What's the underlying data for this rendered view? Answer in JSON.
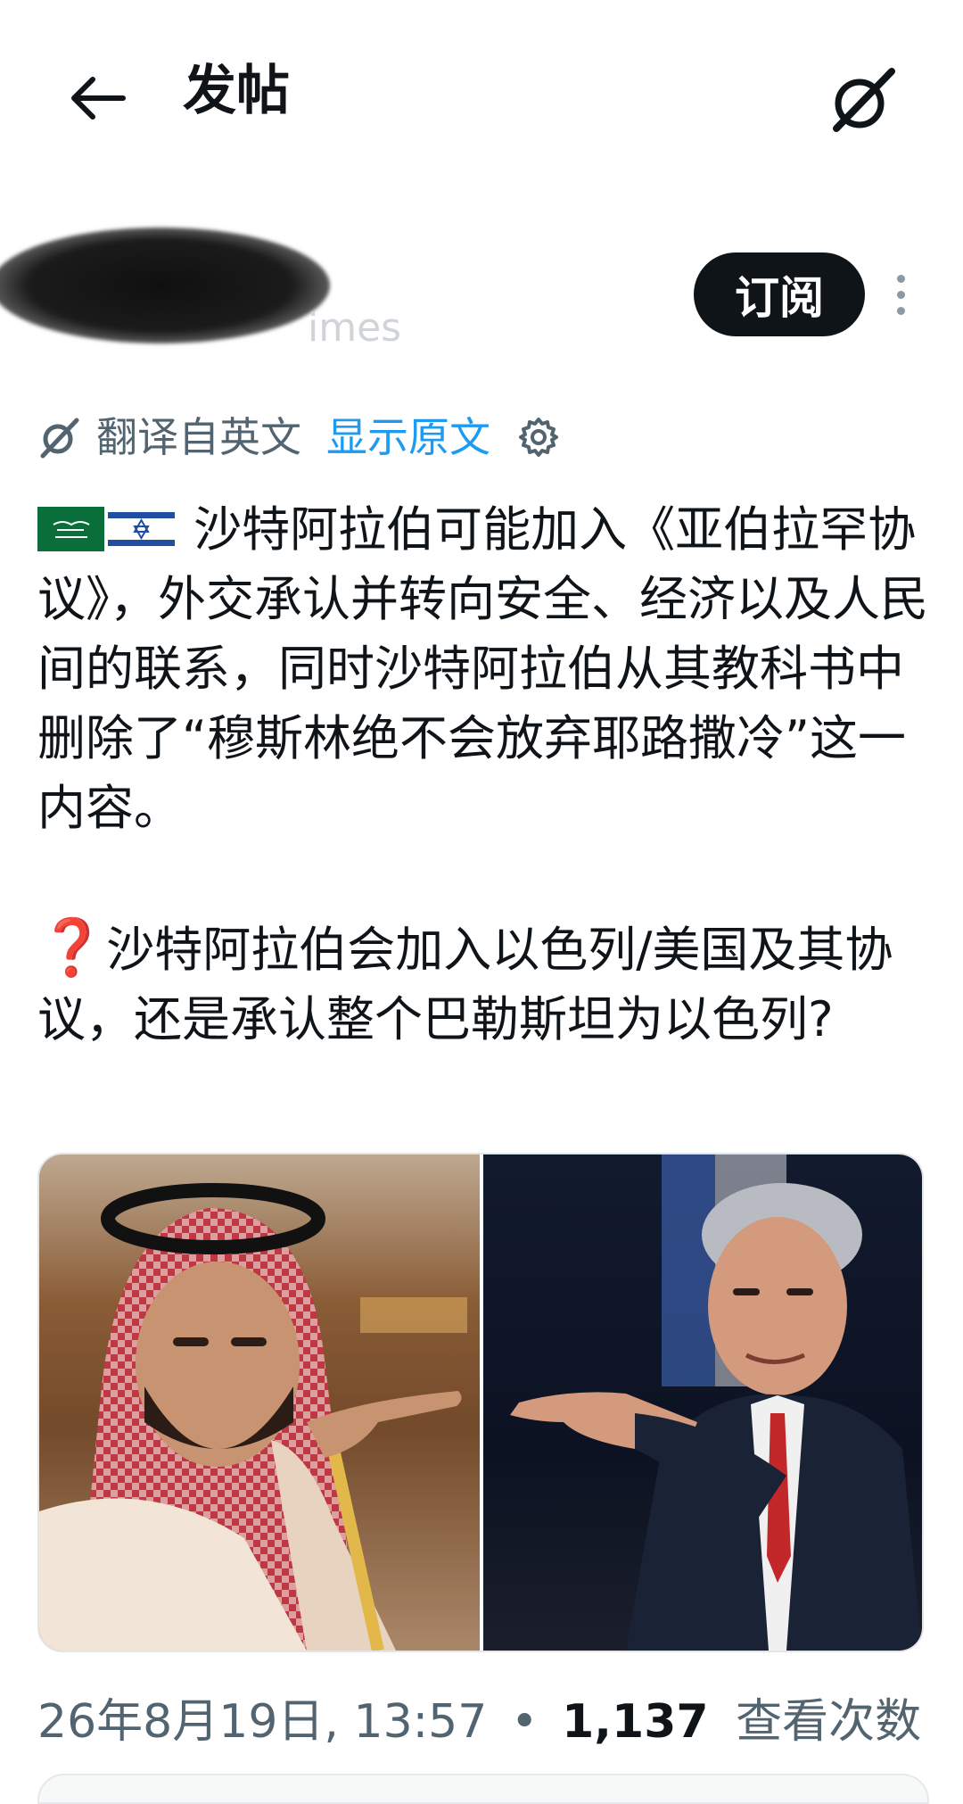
{
  "header": {
    "title": "发帖",
    "back_icon": "arrow-left-icon",
    "grok_icon": "grok-icon"
  },
  "author": {
    "handle_fragment": "imes",
    "subscribe_label": "订阅",
    "more_icon": "more-vertical-icon"
  },
  "translation": {
    "label": "翻译自英文",
    "show_original": "显示原文",
    "settings_icon": "gear-icon",
    "accent_color": "#1d9bf0"
  },
  "post": {
    "flags": [
      "saudi-arabia-flag",
      "israel-flag"
    ],
    "paragraph1": "沙特阿拉伯可能加入《亚伯拉罕协议》，外交承认并转向安全、经济以及人民间的联系，同时沙特阿拉伯从其教科书中删除了“穆斯林绝不会放弃耶路撒冷”这一内容。",
    "question_emoji": "❓",
    "paragraph2": "沙特阿拉伯会加入以色列/美国及其协议，还是承认整个巴勒斯坦为以色列?"
  },
  "media": {
    "photos": [
      "left-photo",
      "right-photo"
    ]
  },
  "meta": {
    "date": "26年8月19日, 13:57",
    "separator": "•",
    "views": "1,137",
    "views_label": "查看次数"
  }
}
